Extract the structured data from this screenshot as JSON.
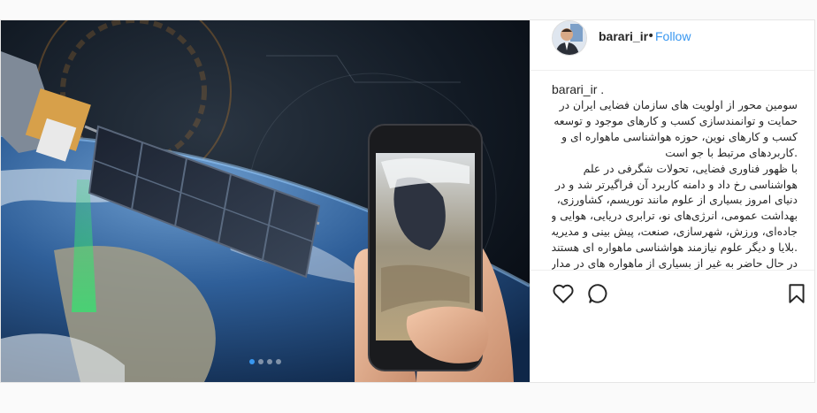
{
  "post": {
    "username": "barari_ir",
    "separator": "•",
    "follow_label": "Follow",
    "caption_username": "barari_ir .",
    "caption_lines": [
      "سومین محور از اولویت های سازمان فضایی ایران در",
      "حمایت و توانمندسازی کسب و کارهای موجود و توسعه",
      "کسب و کارهای نوین، حوزه هواشناسی ماهواره ای و",
      ".کاربردهای مرتبط با جو است",
      "با ظهور فناوری فضایی، تحولات شگرفی در علم",
      "هواشناسی رخ داد و دامنه کاربرد آن فراگیرتر شد و در",
      "دنیای امروز بسیاری از علوم مانند توریسم، کشاورزی،",
      "بهداشت عمومی، انرژی‌های نو، ترابری دریایی، هوایی و",
      "جاده‌ای، ورزش، شهرسازی، صنعت، پیش بینی و مدیریت",
      ".بلایا و دیگر علوم نیازمند هواشناسی ماهواره ای هستند",
      "در حال حاضر به غیر از بسیاری از ماهواره های در مدار"
    ],
    "carousel": {
      "count": 4,
      "active_index": 0
    },
    "icons": {
      "like": "heart-icon",
      "comment": "comment-icon",
      "save": "bookmark-icon"
    },
    "colors": {
      "link": "#3897f0",
      "text": "#262626",
      "border": "#efefef"
    }
  }
}
